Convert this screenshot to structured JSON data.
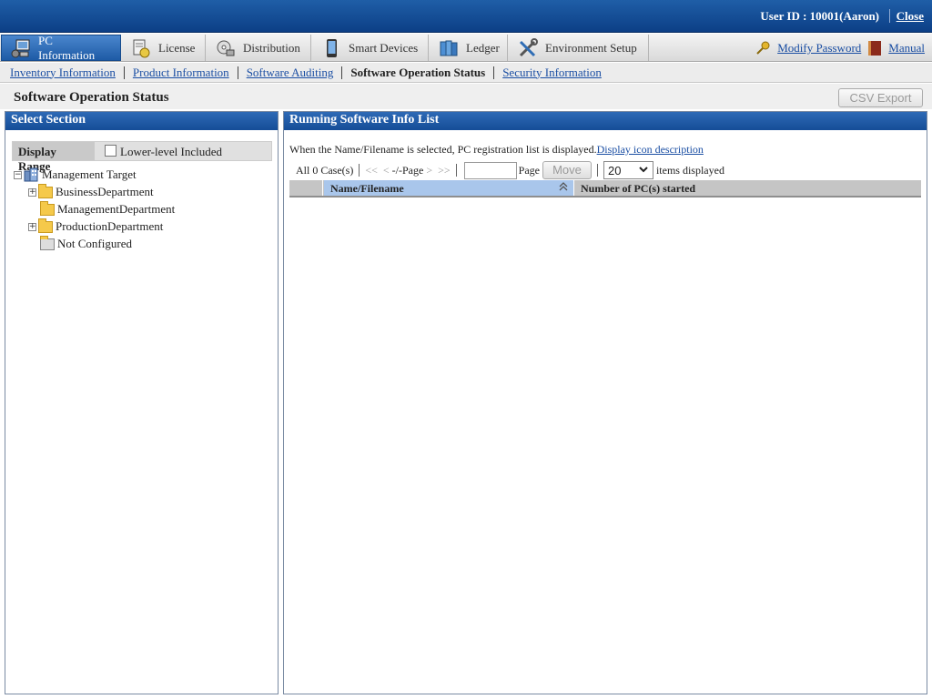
{
  "header": {
    "user_label": "User ID : 10001(Aaron)",
    "close_label": "Close"
  },
  "tabs": [
    {
      "label": "PC Information",
      "icon": "pc-icon",
      "active": true
    },
    {
      "label": "License",
      "icon": "license-icon"
    },
    {
      "label": "Distribution",
      "icon": "distribution-icon"
    },
    {
      "label": "Smart Devices",
      "icon": "smartphone-icon"
    },
    {
      "label": "Ledger",
      "icon": "ledger-icon"
    },
    {
      "label": "Environment Setup",
      "icon": "tools-icon"
    }
  ],
  "top_links": {
    "modify_password": "Modify Password",
    "manual": "Manual"
  },
  "subnav": {
    "inventory": "Inventory Information",
    "product": "Product Information",
    "auditing": "Software Auditing",
    "operation": "Software Operation Status",
    "security": "Security Information"
  },
  "page": {
    "title": "Software Operation Status",
    "csv_export": "CSV Export"
  },
  "left_panel": {
    "title": "Select Section",
    "display_range_label": "Display Range",
    "lower_level_label": "Lower-level Included",
    "lower_level_checked": false,
    "tree": {
      "root": "Management Target",
      "children": [
        "BusinessDepartment",
        "ManagementDepartment",
        "ProductionDepartment",
        "Not Configured"
      ]
    }
  },
  "right_panel": {
    "title": "Running Software Info List",
    "description": "When the Name/Filename is selected, PC registration list is displayed.",
    "icon_desc_link": "Display icon description",
    "case_count": "All 0 Case(s)",
    "nav_first": "<<",
    "nav_prev": "<",
    "page_display": "-/-Page",
    "nav_next": ">",
    "nav_last": ">>",
    "page_label": "Page",
    "move_label": "Move",
    "items_per_page": "20",
    "items_displayed_label": "items displayed",
    "columns": {
      "name": "Name/Filename",
      "count": "Number of PC(s) started"
    },
    "rows": []
  }
}
